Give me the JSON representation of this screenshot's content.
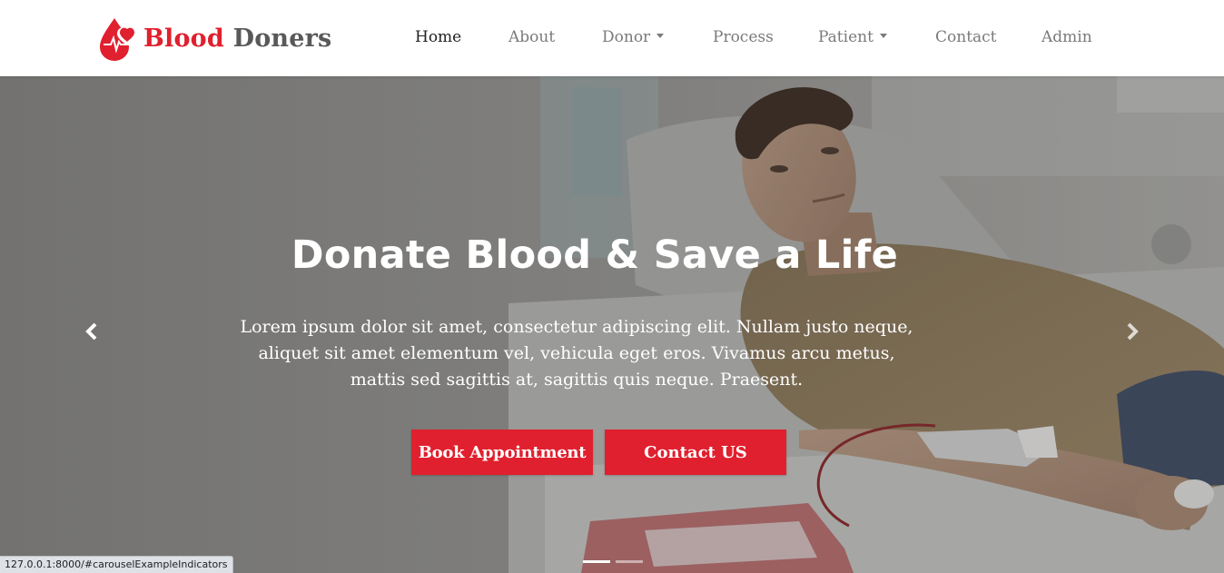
{
  "brand": {
    "word1": "Blood",
    "word2": "Doners"
  },
  "nav": {
    "items": [
      {
        "label": "Home",
        "active": true
      },
      {
        "label": "About"
      },
      {
        "label": "Donor",
        "dropdown": true
      },
      {
        "label": "Process"
      },
      {
        "label": "Patient",
        "dropdown": true
      },
      {
        "label": "Contact"
      },
      {
        "label": "Admin"
      }
    ]
  },
  "hero": {
    "title": "Donate Blood & Save a Life",
    "text": "Lorem ipsum dolor sit amet, consectetur adipiscing elit. Nullam justo neque, aliquet sit amet elementum vel, vehicula eget eros. Vivamus arcu metus, mattis sed sagittis at, sagittis quis neque. Praesent.",
    "book_button": "Book Appointment",
    "contact_button": "Contact US",
    "slide_count": 2,
    "active_slide": 1
  },
  "status_bar": {
    "url": "127.0.0.1:8000/#carouselExampleIndicators"
  },
  "colors": {
    "brand_red": "#e0202e",
    "brand_gray": "#595959"
  },
  "icons": {
    "logo": "blood-drop-heart-icon",
    "prev": "chevron-left-icon",
    "next": "chevron-right-icon"
  }
}
